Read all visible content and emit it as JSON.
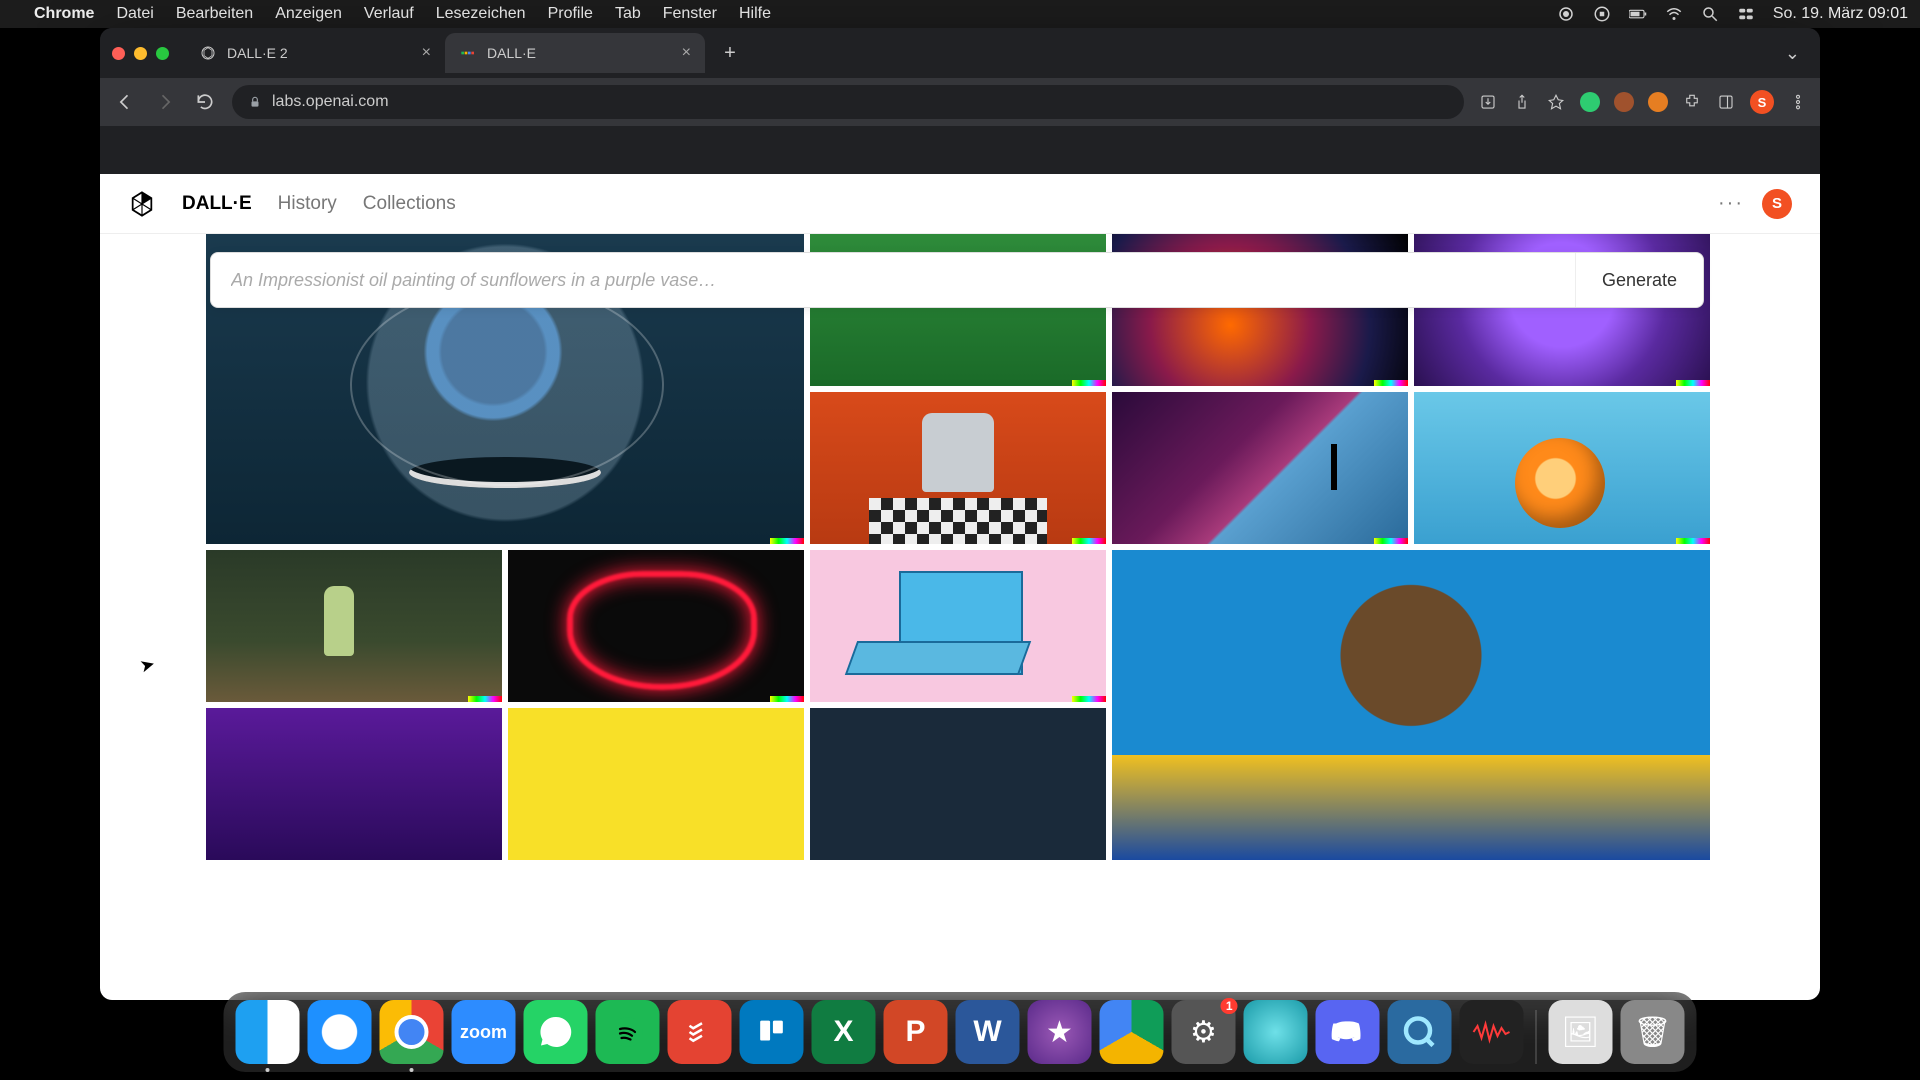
{
  "menubar": {
    "apple": "",
    "app": "Chrome",
    "items": [
      "Datei",
      "Bearbeiten",
      "Anzeigen",
      "Verlauf",
      "Lesezeichen",
      "Profile",
      "Tab",
      "Fenster",
      "Hilfe"
    ],
    "datetime": "So. 19. März  09:01"
  },
  "browser": {
    "tabs": [
      {
        "title": "DALL·E 2",
        "active": false
      },
      {
        "title": "DALL·E",
        "active": true
      }
    ],
    "url": "labs.openai.com",
    "avatar_letter": "S"
  },
  "app": {
    "nav": {
      "brand": "DALL·E",
      "history": "History",
      "collections": "Collections"
    },
    "user_letter": "S",
    "menu_dots": "···",
    "prompt_placeholder": "An Impressionist oil painting of sunflowers in a purple vase…",
    "generate_label": "Generate"
  },
  "dock": {
    "zoom": "zoom",
    "excel": "X",
    "ppt": "P",
    "word": "W",
    "settings_badge": "1"
  }
}
